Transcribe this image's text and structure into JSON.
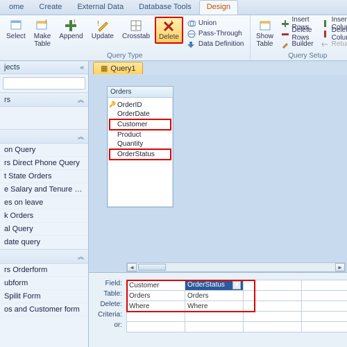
{
  "tabs": {
    "items": [
      "ome",
      "Create",
      "External Data",
      "Database Tools",
      "Design"
    ],
    "active": 4
  },
  "ribbon": {
    "group_querytype_label": "Query Type",
    "group_querysetup_label": "Query Setup",
    "select": "Select",
    "make_table": "Make\nTable",
    "append": "Append",
    "update": "Update",
    "crosstab": "Crosstab",
    "delete": "Delete",
    "union": "Union",
    "pass_through": "Pass-Through",
    "data_definition": "Data Definition",
    "show_table": "Show\nTable",
    "insert_rows": "Insert Rows",
    "delete_rows": "Delete Rows",
    "builder": "Builder",
    "insert_columns": "Insert Columns",
    "delete_columns": "Delete Columns",
    "return": "Return:"
  },
  "nav": {
    "header": "jects",
    "search_placeholder": "",
    "section1": "rs",
    "section2": "",
    "items": [
      "on Query",
      "rs Direct Phone Query",
      "t State Orders",
      "e Salary and Tenure Q...",
      "es on leave",
      "k Orders",
      "al Query",
      "date query"
    ],
    "section3": "",
    "forms": [
      "rs Orderform",
      "ubform",
      "Spilit Form",
      "os and Customer form"
    ]
  },
  "doc": {
    "tab_label": "Query1"
  },
  "tablebox": {
    "title": "Orders",
    "fields": [
      "*",
      "OrderID",
      "OrderDate",
      "Customer",
      "Product",
      "Quantity",
      "OrderStatus"
    ]
  },
  "grid": {
    "labels": [
      "Field:",
      "Table:",
      "Delete:",
      "Criteria:",
      "or:"
    ],
    "col1": {
      "field": "Customer",
      "table": "Orders",
      "delete": "Where"
    },
    "col2": {
      "field": "OrderStatus",
      "table": "Orders",
      "delete": "Where"
    },
    "blank": ""
  }
}
